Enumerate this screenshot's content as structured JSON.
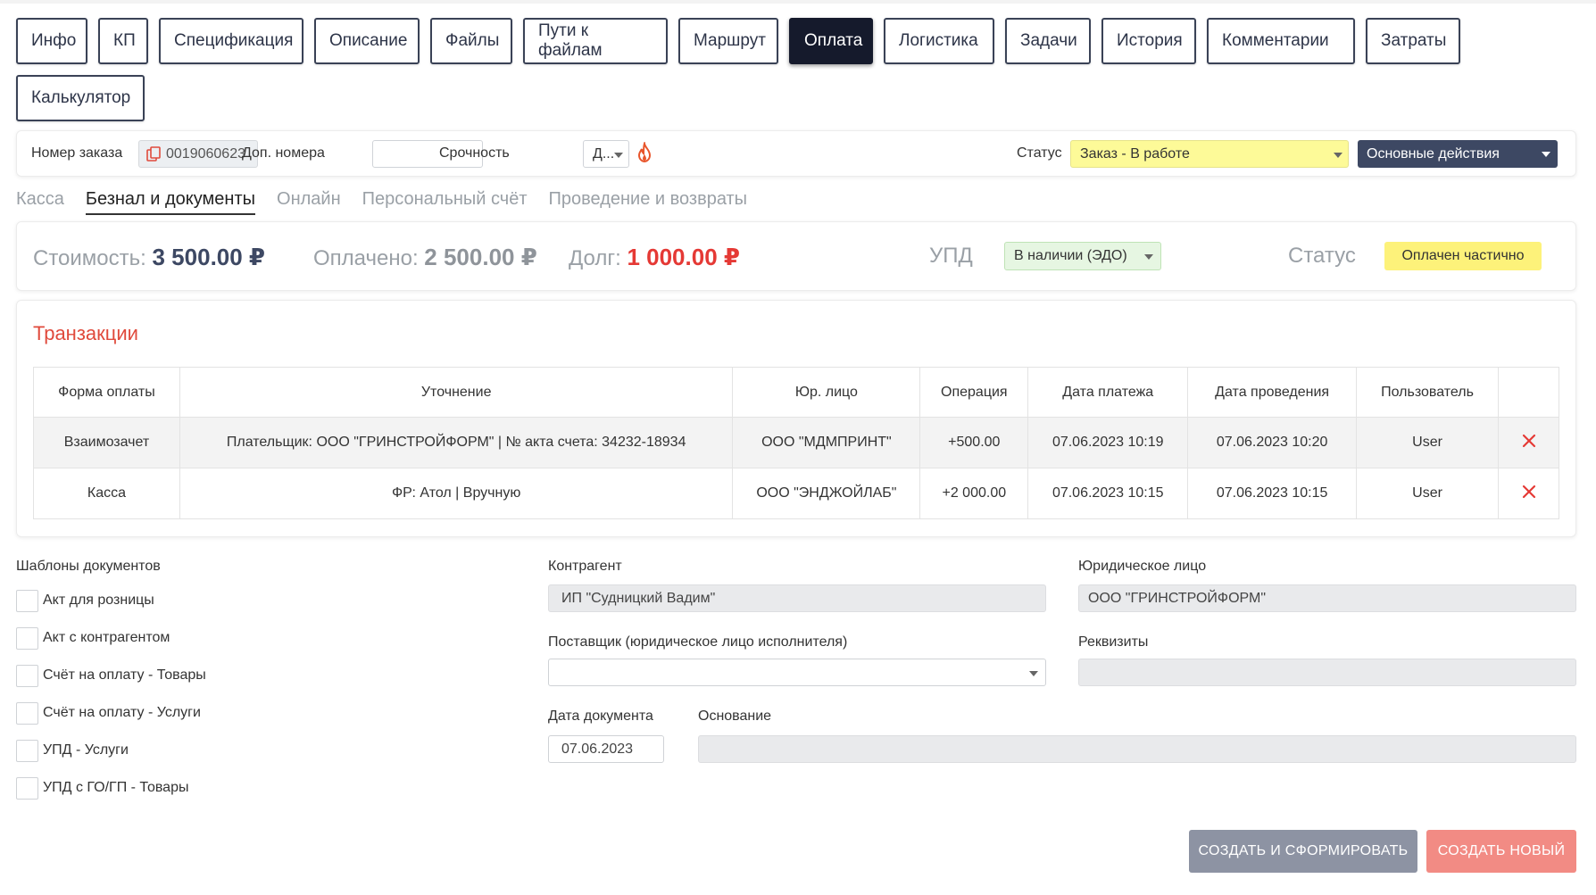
{
  "tabs": [
    {
      "label": "Инфо",
      "cls": "w-info"
    },
    {
      "label": "КП",
      "cls": "w-kp"
    },
    {
      "label": "Спецификация",
      "cls": "w-spec"
    },
    {
      "label": "Описание",
      "cls": "w-desc"
    },
    {
      "label": "Файлы",
      "cls": "w-files"
    },
    {
      "label": "Пути к файлам",
      "cls": "w-paths"
    },
    {
      "label": "Маршрут",
      "cls": "w-route"
    },
    {
      "label": "Оплата",
      "cls": "w-pay",
      "active": true
    },
    {
      "label": "Логистика",
      "cls": "w-log"
    },
    {
      "label": "Задачи",
      "cls": "w-tasks"
    },
    {
      "label": "История",
      "cls": "w-hist"
    },
    {
      "label": "Комментарии",
      "cls": "w-comm"
    },
    {
      "label": "Затраты",
      "cls": "w-cost"
    },
    {
      "label": "Калькулятор",
      "cls": "w-calc"
    }
  ],
  "order": {
    "number_label": "Номер заказа",
    "number_value": "0019060623",
    "extra_label": "Доп. номера",
    "extra_value": "",
    "urgency_label": "Срочность",
    "urgency_value": "Д...",
    "status_label": "Статус",
    "status_value": "Заказ - В работе",
    "actions_label": "Основные действия",
    "status_color": "#fdfa98"
  },
  "subtabs": [
    {
      "label": "Касса"
    },
    {
      "label": "Безнал и документы",
      "active": true
    },
    {
      "label": "Онлайн"
    },
    {
      "label": "Персональный счёт"
    },
    {
      "label": "Проведение и возвраты"
    }
  ],
  "summary": {
    "cost_label": "Стоимость:",
    "cost_value": "3 500.00 ₽",
    "paid_label": "Оплачено:",
    "paid_value": "2 500.00 ₽",
    "debt_label": "Долг:",
    "debt_value": "1 000.00 ₽",
    "upd_label": "УПД",
    "upd_value": "В наличии (ЭДО)",
    "status_label": "Статус",
    "status_value": "Оплачен частично",
    "debt_color": "#e53935"
  },
  "transactions": {
    "title": "Транзакции",
    "columns": [
      "Форма оплаты",
      "Уточнение",
      "Юр. лицо",
      "Операция",
      "Дата платежа",
      "Дата проведения",
      "Пользователь",
      ""
    ],
    "rows": [
      [
        "Взаимозачет",
        "Плательщик: ООО \"ГРИНСТРОЙФОРМ\" | № акта счета: 34232-18934",
        "ООО \"МДМПРИНТ\"",
        "+500.00",
        "07.06.2023 10:19",
        "07.06.2023 10:20",
        "User"
      ],
      [
        "Касса",
        "ФР: Атол | Вручную",
        "ООО \"ЭНДЖОЙЛАБ\"",
        "+2 000.00",
        "07.06.2023 10:15",
        "07.06.2023 10:15",
        "User"
      ]
    ]
  },
  "templates": {
    "title": "Шаблоны документов",
    "items": [
      "Акт для розницы",
      "Акт с контрагентом",
      "Счёт на оплату - Товары",
      "Счёт на оплату - Услуги",
      "УПД - Услуги",
      "УПД с ГО/ГП - Товары"
    ]
  },
  "form": {
    "counterparty_label": "Контрагент",
    "counterparty_value": "ИП \"Судницкий Вадим\"",
    "legal_label": "Юридическое лицо",
    "legal_value": "ООО \"ГРИНСТРОЙФОРМ\"",
    "supplier_label": "Поставщик (юридическое лицо исполнителя)",
    "supplier_value": "",
    "requisites_label": "Реквизиты",
    "requisites_value": "",
    "doc_date_label": "Дата документа",
    "doc_date_value": "07.06.2023",
    "basis_label": "Основание",
    "basis_value": ""
  },
  "buttons": {
    "create_form": "СОЗДАТЬ И СФОРМИРОВАТЬ",
    "create_new": "СОЗДАТЬ НОВЫЙ"
  }
}
